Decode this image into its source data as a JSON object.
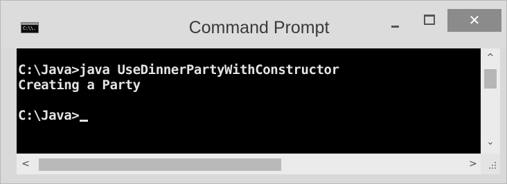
{
  "window": {
    "title": "Command Prompt",
    "icon_text": "C:\\\\.",
    "icon": "console-app-icon"
  },
  "titlebar_buttons": {
    "minimize_icon": "minimize-icon",
    "maximize_icon": "maximize-icon",
    "close_icon": "close-icon",
    "close_glyph": "✕"
  },
  "console": {
    "lines": [
      "C:\\Java>java UseDinnerPartyWithConstructor",
      "Creating a Party",
      "",
      "C:\\Java>"
    ],
    "colors": {
      "background": "#000000",
      "text": "#e4e4e4"
    }
  },
  "scrollbars": {
    "up_glyph": "^",
    "down_glyph": "⌄",
    "left_glyph": "<",
    "right_glyph": ">"
  }
}
